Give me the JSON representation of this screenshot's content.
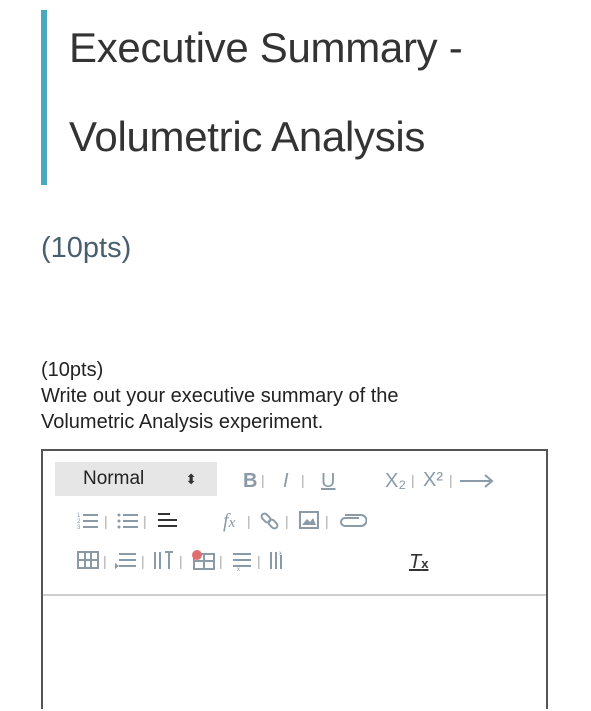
{
  "heading": {
    "line1": "Executive Summary -",
    "line2": "Volumetric Analysis",
    "accent_color": "#4aa8bd"
  },
  "points_heading": "(10pts)",
  "question": {
    "points": "(10pts)",
    "line1": "Write out your executive summary of the",
    "line2": "Volumetric Analysis experiment."
  },
  "editor": {
    "format_select": {
      "value": "Normal"
    },
    "toolbar_icons": [
      "bold-icon",
      "italic-icon",
      "underline-icon",
      "subscript-icon",
      "superscript-icon",
      "arrow-right-icon",
      "ordered-list-icon",
      "unordered-list-icon",
      "align-icon",
      "formula-icon",
      "link-icon",
      "image-icon",
      "attachment-icon",
      "table-icon",
      "indent-icon",
      "column-icon",
      "table-delete-icon",
      "row-icon",
      "column-delete-icon",
      "clear-format-icon"
    ],
    "labels": {
      "bold": "B",
      "italic": "I",
      "underline": "U",
      "subscript": "X₂",
      "superscript": "X²",
      "formula": "fx",
      "clear": "Tx"
    },
    "content": ""
  }
}
